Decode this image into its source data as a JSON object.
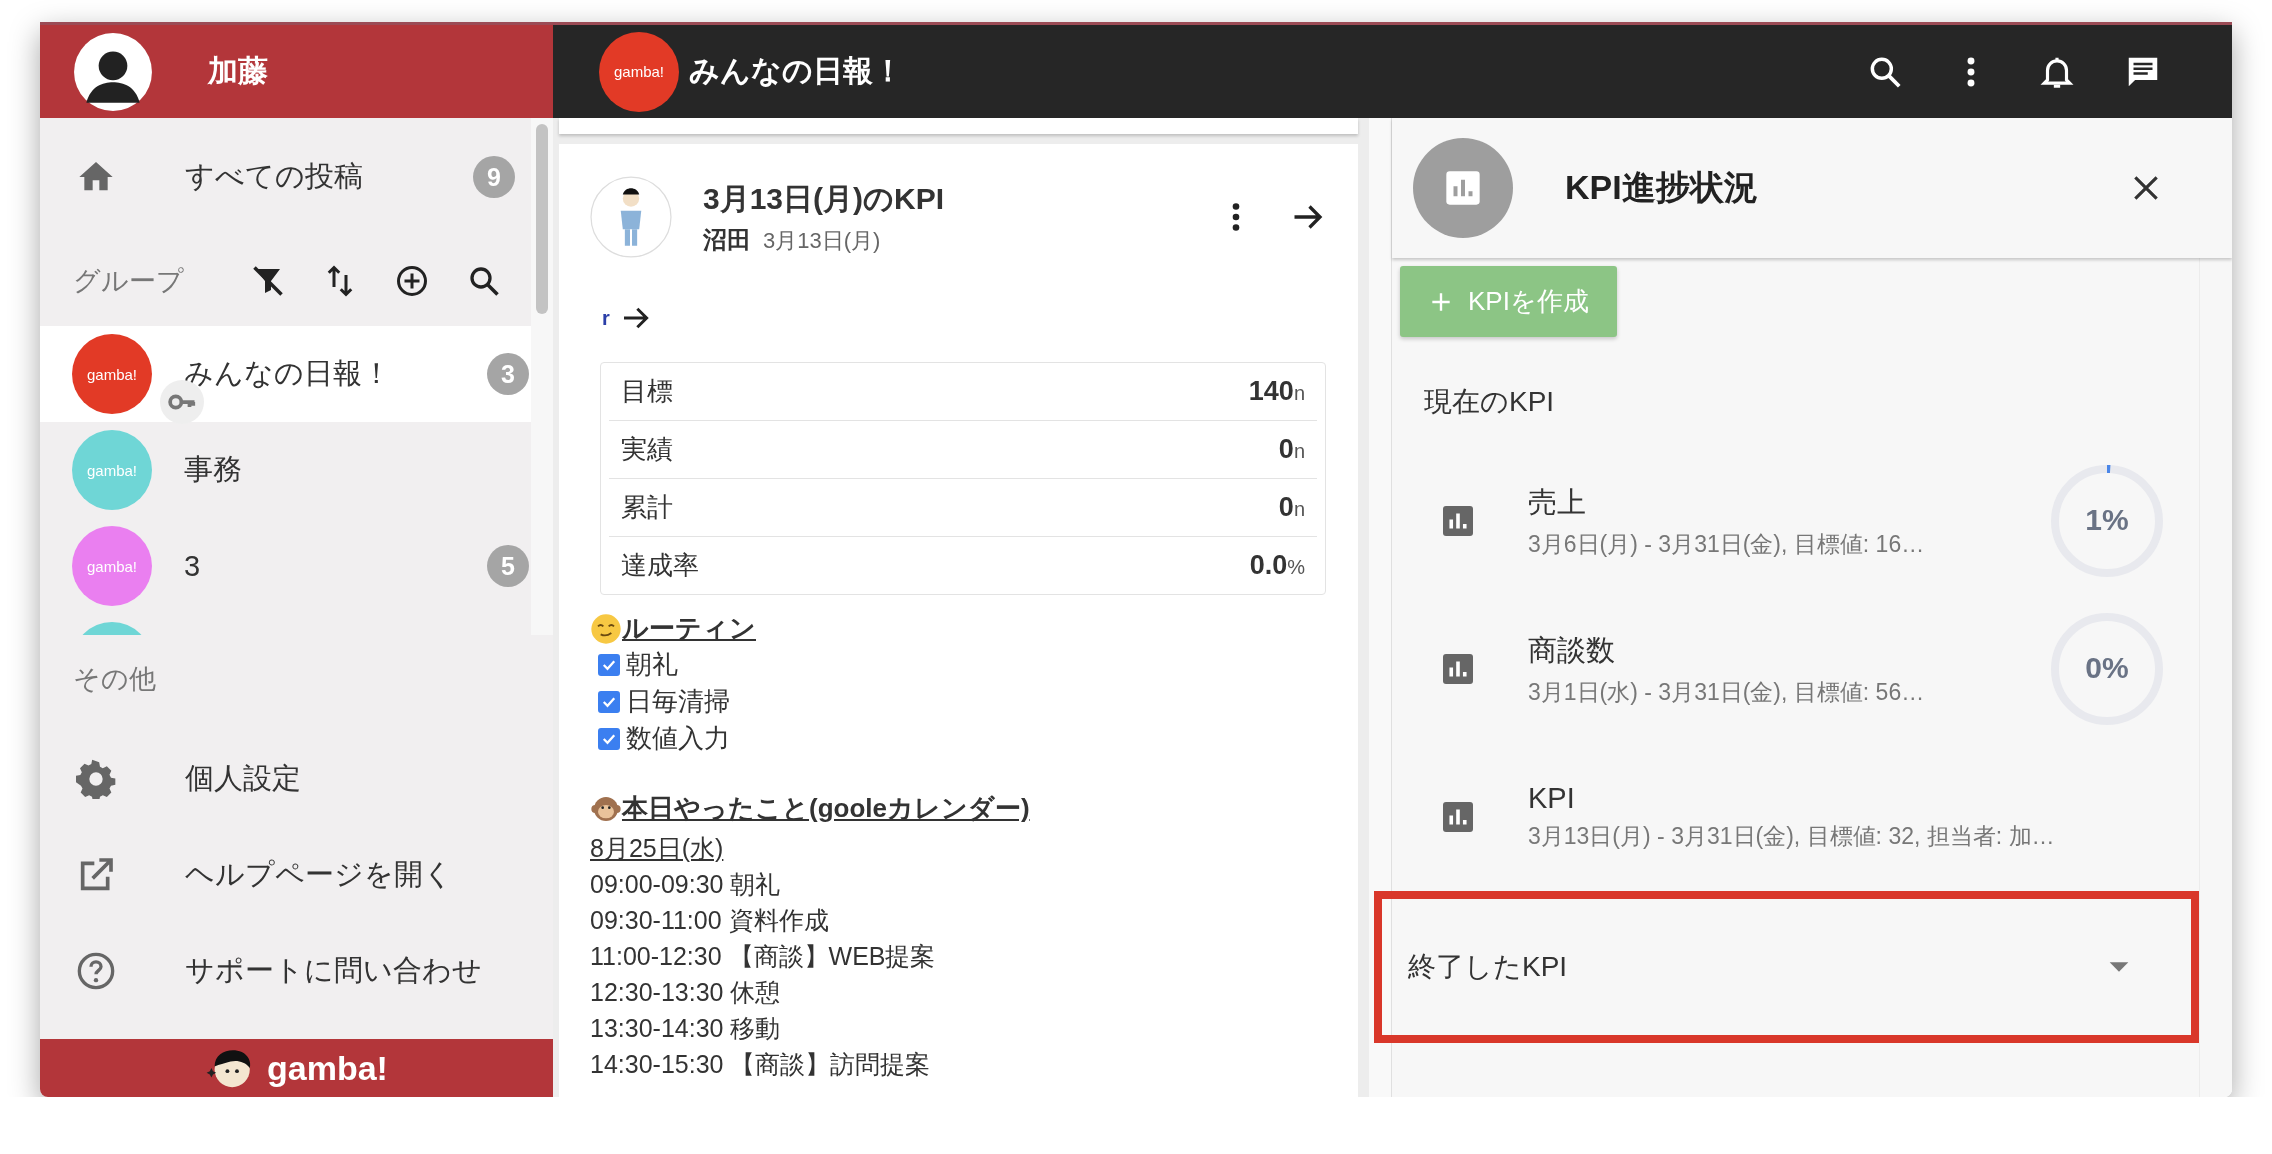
{
  "sidebar": {
    "user_name": "加藤",
    "nav_items": [
      {
        "label": "すべての投稿",
        "count": "9"
      }
    ],
    "groups_heading": "グループ",
    "groups": [
      {
        "avatar_text": "gamba!",
        "name": "みんなの日報！",
        "count": "3",
        "color": "#e23a26",
        "selected": true,
        "key_badge": true
      },
      {
        "avatar_text": "gamba!",
        "name": "事務",
        "color": "#6fd6d6",
        "selected": false,
        "key_badge": false
      },
      {
        "avatar_text": "gamba!",
        "name": "3",
        "count": "5",
        "color": "#ea7ff0",
        "selected": false,
        "key_badge": false
      },
      {
        "color": "#6fd6d6",
        "selected": false,
        "key_badge": false
      }
    ],
    "other_heading": "その他",
    "other_items": [
      {
        "kind": "settings",
        "label": "個人設定"
      },
      {
        "kind": "external",
        "label": "ヘルプページを開く"
      },
      {
        "kind": "help",
        "label": "サポートに問い合わせ"
      }
    ],
    "footer_logo": "gamba!"
  },
  "header": {
    "group_avatar_text": "gamba!",
    "title": "みんなの日報！"
  },
  "post": {
    "title": "3月13日(月)のKPI",
    "author": "沼田",
    "date": "3月13日(月)",
    "link_mark": "r",
    "kpi_table": [
      {
        "label": "目標",
        "value": "140",
        "unit": "n"
      },
      {
        "label": "実績",
        "value": "0",
        "unit": "n"
      },
      {
        "label": "累計",
        "value": "0",
        "unit": "n"
      },
      {
        "label": "達成率",
        "value": "0.0",
        "unit": "%"
      }
    ],
    "routine": {
      "heading": "ルーティン",
      "items": [
        {
          "label": "朝礼",
          "checked": true
        },
        {
          "label": "日毎清掃",
          "checked": true
        },
        {
          "label": "数値入力",
          "checked": true
        }
      ]
    },
    "schedule": {
      "heading": "本日やったこと(gooleカレンダー)",
      "date": "8月25日(水)",
      "lines": [
        "09:00-09:30 朝礼",
        "09:30-11:00 資料作成",
        "11:00-12:30 【商談】WEB提案",
        "12:30-13:30 休憩",
        "13:30-14:30 移動",
        "14:30-15:30 【商談】訪問提案"
      ]
    }
  },
  "kpi_panel": {
    "title": "KPI進捗状況",
    "create_button": "KPIを作成",
    "current_heading": "現在のKPI",
    "kpis": [
      {
        "name": "売上",
        "detail": "3月6日(月) - 3月31日(金), 目標値: 16…",
        "percent": "1%",
        "level": 0.01
      },
      {
        "name": "商談数",
        "detail": "3月1日(水) - 3月31日(金), 目標値: 56…",
        "percent": "0%",
        "level": 0
      },
      {
        "name": "KPI",
        "detail": "3月13日(月) - 3月31日(金), 目標値: 32, 担当者: 加…"
      }
    ],
    "ended": {
      "label": "終了したKPI",
      "expanded": false,
      "highlighted": true
    }
  }
}
